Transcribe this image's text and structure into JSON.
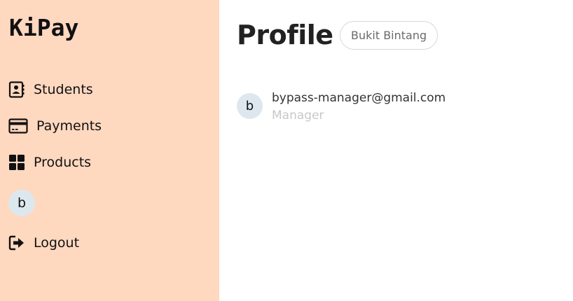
{
  "app": {
    "brand": "KiPay"
  },
  "sidebar": {
    "items": [
      {
        "label": "Students",
        "icon": "contact-book-icon"
      },
      {
        "label": "Payments",
        "icon": "credit-card-icon"
      },
      {
        "label": "Products",
        "icon": "grid-icon"
      }
    ],
    "avatar_initial": "b",
    "logout_label": "Logout",
    "logout_icon": "logout-icon",
    "background_color": "#ffd8c0"
  },
  "main": {
    "title": "Profile",
    "location": "Bukit Bintang",
    "profile": {
      "avatar_initial": "b",
      "email": "bypass-manager@gmail.com",
      "role": "Manager"
    }
  }
}
